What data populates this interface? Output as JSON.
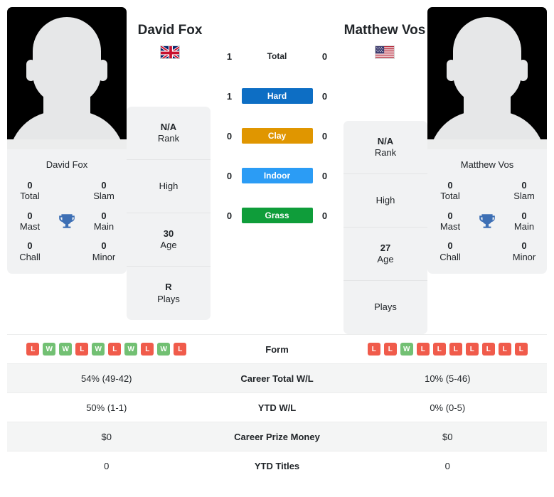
{
  "players": {
    "left": {
      "name": "David Fox",
      "photo_name": "David Fox",
      "flag": "uk-flag",
      "trophies": [
        {
          "num": "0",
          "label": "Total"
        },
        {
          "num": "0",
          "label": "Slam"
        },
        {
          "num": "0",
          "label": "Mast"
        },
        {
          "num": "0",
          "label": "Main"
        },
        {
          "num": "0",
          "label": "Chall"
        },
        {
          "num": "0",
          "label": "Minor"
        }
      ],
      "stats": [
        {
          "value": "N/A",
          "label": "Rank"
        },
        {
          "value": "",
          "label": "High"
        },
        {
          "value": "30",
          "label": "Age"
        },
        {
          "value": "R",
          "label": "Plays"
        }
      ],
      "form": [
        "L",
        "W",
        "W",
        "L",
        "W",
        "L",
        "W",
        "L",
        "W",
        "L"
      ]
    },
    "right": {
      "name": "Matthew Vos",
      "photo_name": "Matthew Vos",
      "flag": "us-flag",
      "trophies": [
        {
          "num": "0",
          "label": "Total"
        },
        {
          "num": "0",
          "label": "Slam"
        },
        {
          "num": "0",
          "label": "Mast"
        },
        {
          "num": "0",
          "label": "Main"
        },
        {
          "num": "0",
          "label": "Chall"
        },
        {
          "num": "0",
          "label": "Minor"
        }
      ],
      "stats": [
        {
          "value": "N/A",
          "label": "Rank"
        },
        {
          "value": "",
          "label": "High"
        },
        {
          "value": "27",
          "label": "Age"
        },
        {
          "value": "",
          "label": "Plays"
        }
      ],
      "form": [
        "L",
        "L",
        "W",
        "L",
        "L",
        "L",
        "L",
        "L",
        "L",
        "L"
      ]
    }
  },
  "h2h": [
    {
      "label": "Total",
      "left": "1",
      "right": "0",
      "style": "plain"
    },
    {
      "label": "Hard",
      "left": "1",
      "right": "0",
      "style": "badge",
      "color": "#0d6ec4"
    },
    {
      "label": "Clay",
      "left": "0",
      "right": "0",
      "style": "badge",
      "color": "#e09600"
    },
    {
      "label": "Indoor",
      "left": "0",
      "right": "0",
      "style": "badge",
      "color": "#2b9cf5"
    },
    {
      "label": "Grass",
      "left": "0",
      "right": "0",
      "style": "badge",
      "color": "#0f9d3a"
    }
  ],
  "table": [
    {
      "label": "Form",
      "left": "",
      "right": "",
      "type": "form"
    },
    {
      "label": "Career Total W/L",
      "left": "54% (49-42)",
      "right": "10% (5-46)",
      "type": "text"
    },
    {
      "label": "YTD W/L",
      "left": "50% (1-1)",
      "right": "0% (0-5)",
      "type": "text"
    },
    {
      "label": "Career Prize Money",
      "left": "$0",
      "right": "$0",
      "type": "text"
    },
    {
      "label": "YTD Titles",
      "left": "0",
      "right": "0",
      "type": "text"
    }
  ],
  "colors": {
    "win": "#72c073",
    "loss": "#f05b4b",
    "trophy": "#3d6fb4",
    "card_bg": "#f1f2f3"
  }
}
